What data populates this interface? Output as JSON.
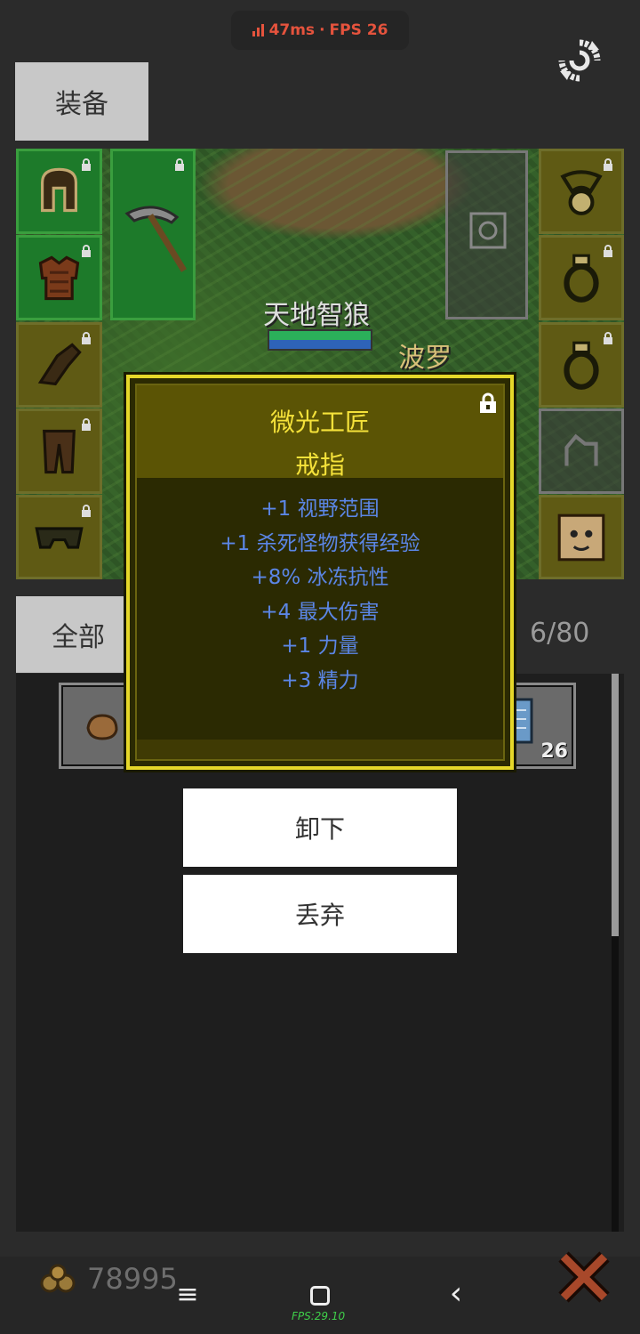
{
  "status": {
    "ping": "47ms",
    "separator": "·",
    "fps": "FPS 26",
    "color": "#e5533d"
  },
  "tabs": {
    "equip": "装备",
    "all": "全部"
  },
  "scene": {
    "monster_name": "天地智狼",
    "npc_name": "波罗",
    "monster_hp_fraction": 1.0,
    "monster_mp_fraction": 1.0
  },
  "inventory": {
    "capacity": "6/80",
    "scroll_quantity": "26"
  },
  "tooltip": {
    "name": "微光工匠",
    "type": "戒指",
    "stats": [
      "+1 视野范围",
      "+1 杀死怪物获得经验",
      "+8% 冰冻抗性",
      "+4 最大伤害",
      "+1 力量",
      "+3 精力"
    ],
    "name_color": "#f5e23a",
    "stat_color": "#5b86e6"
  },
  "actions": {
    "unequip": "卸下",
    "discard": "丢弃"
  },
  "footer": {
    "gold": "78995",
    "fps_overlay": "FPS:29.10"
  },
  "icons": [
    "sync-icon",
    "lock-icon",
    "gold-coins-icon",
    "close-x-icon",
    "nav-menu-icon",
    "nav-home-icon",
    "nav-back-icon"
  ]
}
